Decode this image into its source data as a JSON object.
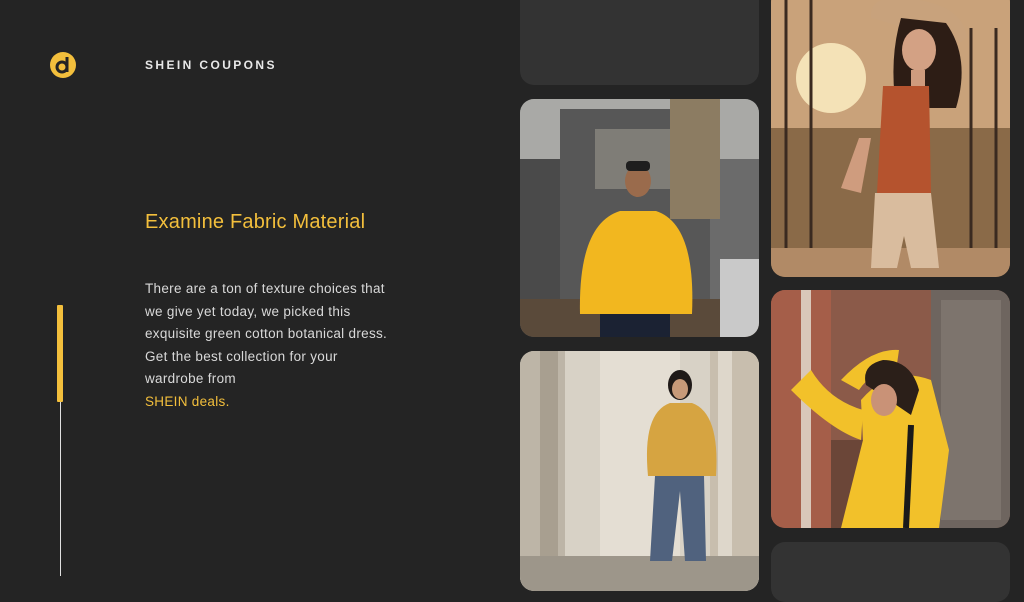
{
  "header": {
    "logo_letter": "d",
    "brand": "SHEIN COUPONS",
    "accent_color": "#f3bf3c"
  },
  "main": {
    "heading": "Examine Fabric Material",
    "paragraph": "There are a ton of texture choices that we give yet today, we picked this exquisite green cotton botanical dress. Get the best collection for your wardrobe from",
    "link_text": "SHEIN deals."
  },
  "gallery": {
    "photos": [
      "man-yellow-hoodie-photo",
      "woman-rust-top-photo",
      "woman-yellow-puffer-photo",
      "woman-yellow-sweater-photo"
    ]
  }
}
